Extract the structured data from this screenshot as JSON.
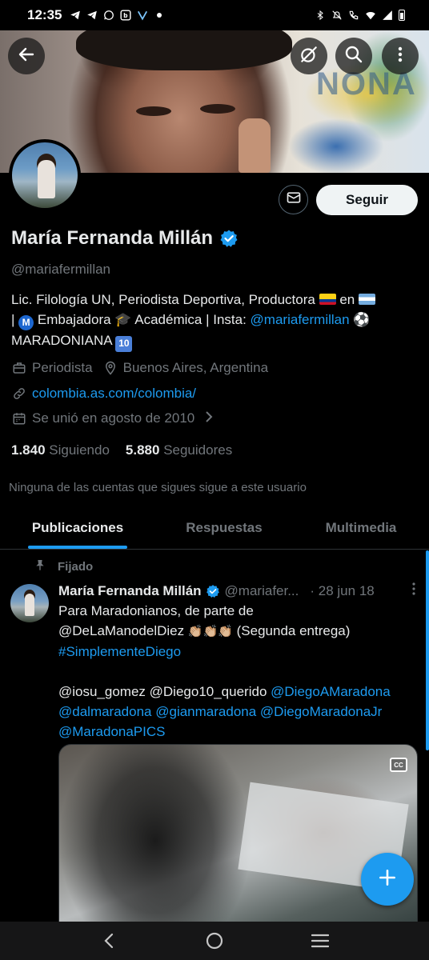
{
  "status_bar": {
    "time": "12:35",
    "left_icons": [
      "telegram-icon",
      "telegram-icon",
      "whatsapp-icon",
      "app-b-icon",
      "app-v-icon",
      "dot-icon"
    ],
    "right_icons": [
      "bluetooth-icon",
      "mute-icon",
      "call-wifi-icon",
      "wifi-icon",
      "signal-icon",
      "battery-icon"
    ]
  },
  "banner": {
    "back_icon": "arrow-left-icon",
    "grok_icon": "grok-icon",
    "search_icon": "search-icon",
    "more_icon": "more-vertical-icon",
    "text": "NONA"
  },
  "profile": {
    "name": "María Fernanda Millán",
    "handle": "@mariafermillan",
    "follow_label": "Seguir",
    "verified": true,
    "accent_color": "#1d9bf0",
    "bio": {
      "line1_a": "Lic. Filología UN, Periodista Deportiva, Productora",
      "line1_b": "en",
      "line2_a": "|",
      "line2_m": "M",
      "line2_b": "Embajadora",
      "line2_c": "Académica | Insta:",
      "line2_link": "@mariafermillan",
      "line3_a": "MARADONIANA",
      "line3_ten": "10"
    },
    "profession": "Periodista",
    "location": "Buenos Aires, Argentina",
    "website": "colombia.as.com/colombia/",
    "joined": "Se unió en agosto de 2010",
    "following_count": "1.840",
    "following_label": "Siguiendo",
    "followers_count": "5.880",
    "followers_label": "Seguidores",
    "no_mutual": "Ninguna de las cuentas que sigues sigue a este usuario"
  },
  "tabs": [
    {
      "label": "Publicaciones",
      "active": true
    },
    {
      "label": "Respuestas",
      "active": false
    },
    {
      "label": "Multimedia",
      "active": false
    }
  ],
  "tweet": {
    "pinned_label": "Fijado",
    "name": "María Fernanda Millán",
    "handle": "@mariafer...",
    "date": "· 28 jun 18",
    "line1": "Para Maradonianos, de parte de",
    "line2_a": "@DeLaManodelDiez",
    "line2_b": "(Segunda entrega)",
    "hashtag": "#SimplementeDiego",
    "mentions_plain": "@iosu_gomez @Diego10_querido",
    "mention_1": "@DiegoAMaradona",
    "mention_2": "@dalmaradona",
    "mention_3": "@gianmaradona",
    "mention_4": "@DiegoMaradonaJr",
    "mention_5": "@MaradonaPICS",
    "cc_label": "CC"
  },
  "fab": {
    "icon": "plus-icon"
  },
  "nav_bar": {
    "icons": [
      "back-nav-icon",
      "home-nav-icon",
      "recents-nav-icon"
    ]
  }
}
